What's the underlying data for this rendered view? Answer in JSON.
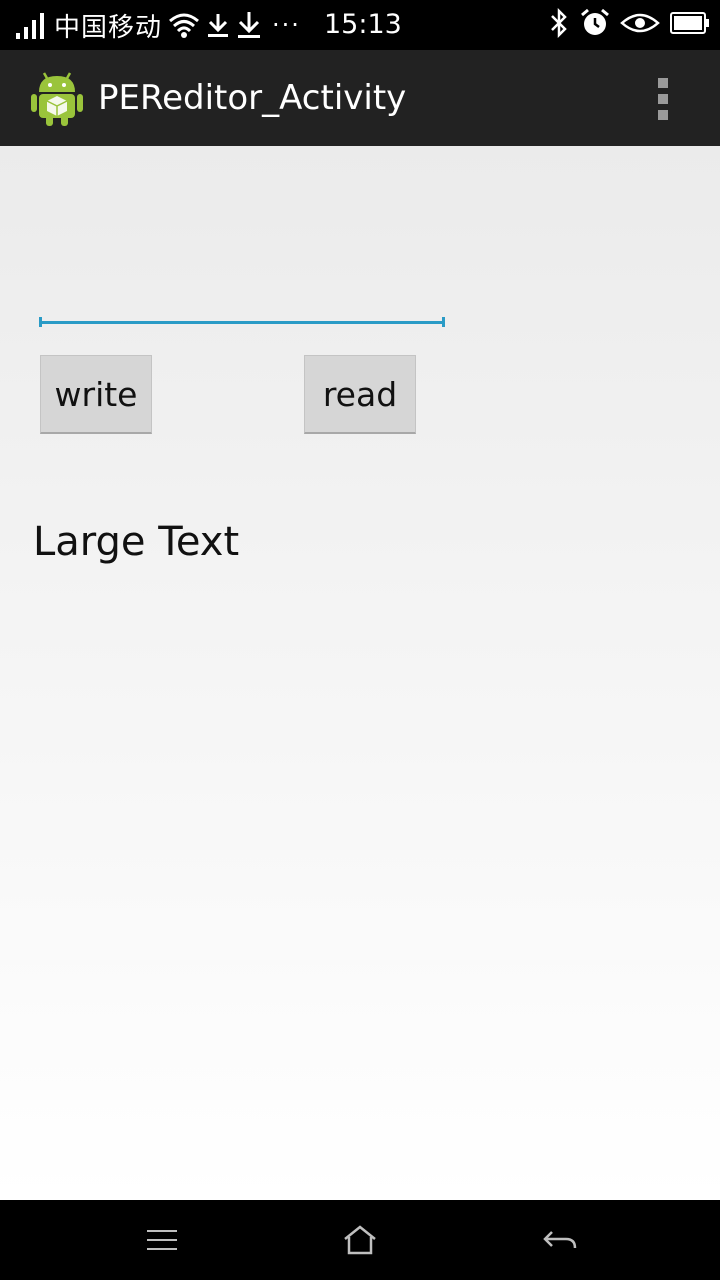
{
  "status_bar": {
    "carrier": "中国移动",
    "time": "15:13",
    "overflow_dots": "···",
    "icons": [
      "signal-icon",
      "wifi-icon",
      "download-icon",
      "download-icon",
      "bluetooth-icon",
      "alarm-icon",
      "eye-icon",
      "battery-icon"
    ]
  },
  "action_bar": {
    "title": "PEReditor_Activity",
    "icons": [
      "android-app-icon",
      "overflow-menu-icon"
    ],
    "background": "#222222"
  },
  "main": {
    "edit_field": {
      "value": "",
      "placeholder": "",
      "underline_color": "#2a9bc6"
    },
    "write_button": "write",
    "read_button": "read",
    "large_text": "Large Text"
  },
  "nav_bar": {
    "icons": [
      "menu-icon",
      "home-icon",
      "back-icon"
    ]
  }
}
